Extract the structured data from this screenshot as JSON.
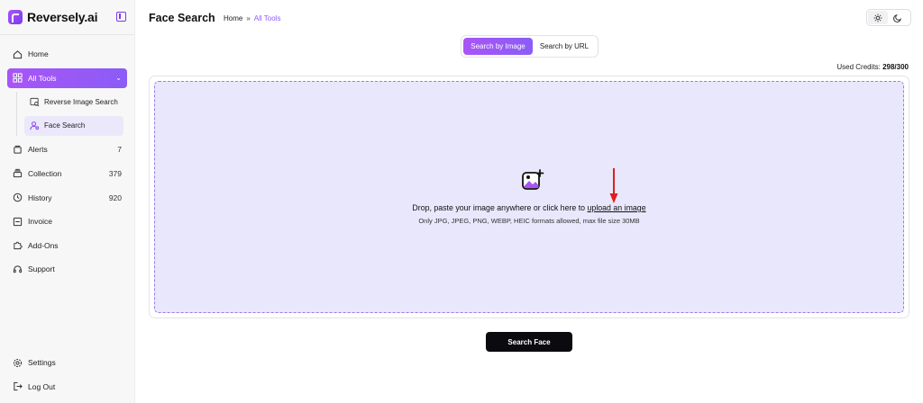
{
  "app": {
    "name": "Reversely.ai"
  },
  "sidebar": {
    "items": [
      {
        "label": "Home",
        "count": ""
      },
      {
        "label": "All Tools",
        "count": ""
      },
      {
        "label": "Alerts",
        "count": "7"
      },
      {
        "label": "Collection",
        "count": "379"
      },
      {
        "label": "History",
        "count": "920"
      },
      {
        "label": "Invoice",
        "count": ""
      },
      {
        "label": "Add-Ons",
        "count": ""
      },
      {
        "label": "Support",
        "count": ""
      }
    ],
    "subitems": [
      {
        "label": "Reverse Image Search"
      },
      {
        "label": "Face Search"
      }
    ],
    "bottom": [
      {
        "label": "Settings"
      },
      {
        "label": "Log Out"
      }
    ]
  },
  "header": {
    "title": "Face Search",
    "breadcrumb": {
      "home": "Home",
      "separator": "»",
      "current": "All Tools"
    }
  },
  "tabs": [
    {
      "label": "Search by Image",
      "active": true
    },
    {
      "label": "Search by URL",
      "active": false
    }
  ],
  "credits": {
    "label": "Used Credits:",
    "value": "298/300"
  },
  "dropzone": {
    "text": "Drop, paste your image anywhere or click here to ",
    "link": "upload an image",
    "hint": "Only JPG, JPEG, PNG, WEBP, HEIC formats allowed, max file size 30MB"
  },
  "actions": {
    "search_label": "Search Face"
  },
  "colors": {
    "accent": "#8b5cf6",
    "accent_light": "#e9e7fc",
    "button_dark": "#0b0b0f",
    "annotation_arrow": "#e11d1d"
  },
  "icons": {
    "home": "home-icon",
    "all_tools": "grid-icon",
    "reverse_image": "image-search-icon",
    "face_search": "user-search-icon",
    "alerts": "bell-icon",
    "collection": "stack-icon",
    "history": "clock-icon",
    "invoice": "receipt-icon",
    "addons": "puzzle-icon",
    "support": "headset-icon",
    "settings": "gear-icon",
    "logout": "logout-icon"
  }
}
